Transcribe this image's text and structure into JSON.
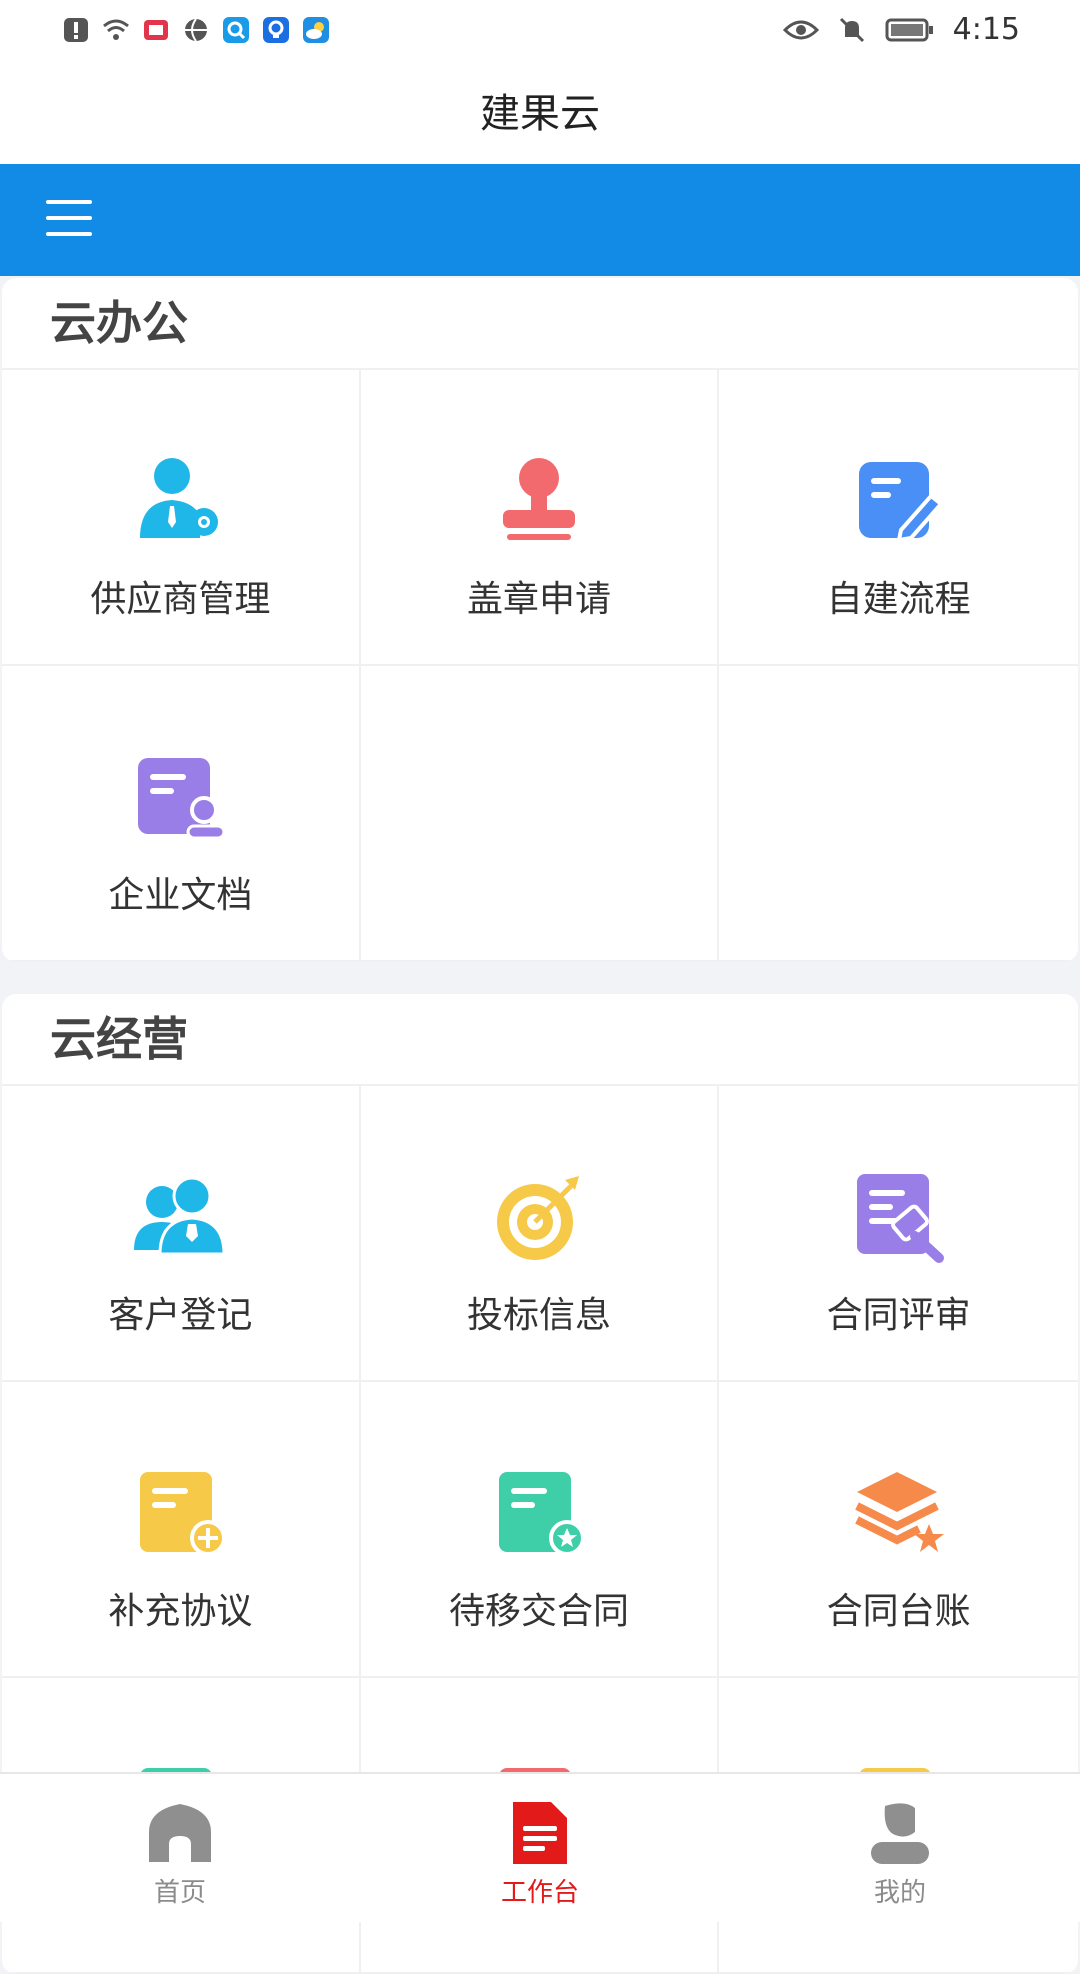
{
  "status_bar": {
    "time": "4:15",
    "left_icons": [
      "alert-icon",
      "wifi-icon",
      "book-icon",
      "globe-icon",
      "search-app-icon",
      "bulb-app-icon",
      "weather-app-icon"
    ],
    "right_icons": [
      "eye-icon",
      "bell-off-icon",
      "battery-icon"
    ]
  },
  "header": {
    "title": "建果云"
  },
  "sections": [
    {
      "title": "云办公",
      "items": [
        {
          "label": "供应商管理",
          "icon": "supplier-icon"
        },
        {
          "label": "盖章申请",
          "icon": "stamp-icon"
        },
        {
          "label": "自建流程",
          "icon": "edit-doc-icon"
        },
        {
          "label": "企业文档",
          "icon": "enterprise-doc-icon"
        }
      ]
    },
    {
      "title": "云经营",
      "items": [
        {
          "label": "客户登记",
          "icon": "customers-icon"
        },
        {
          "label": "投标信息",
          "icon": "target-icon"
        },
        {
          "label": "合同评审",
          "icon": "contract-review-icon"
        },
        {
          "label": "补充协议",
          "icon": "agreement-plus-icon"
        },
        {
          "label": "待移交合同",
          "icon": "contract-star-icon"
        },
        {
          "label": "合同台账",
          "icon": "ledger-icon"
        }
      ]
    }
  ],
  "tabbar": {
    "items": [
      {
        "label": "首页",
        "icon": "home-icon"
      },
      {
        "label": "工作台",
        "icon": "workbench-icon",
        "active": true
      },
      {
        "label": "我的",
        "icon": "profile-icon"
      }
    ]
  },
  "colors": {
    "accent_blue": "#128be6",
    "active_red": "#e21a1a"
  }
}
